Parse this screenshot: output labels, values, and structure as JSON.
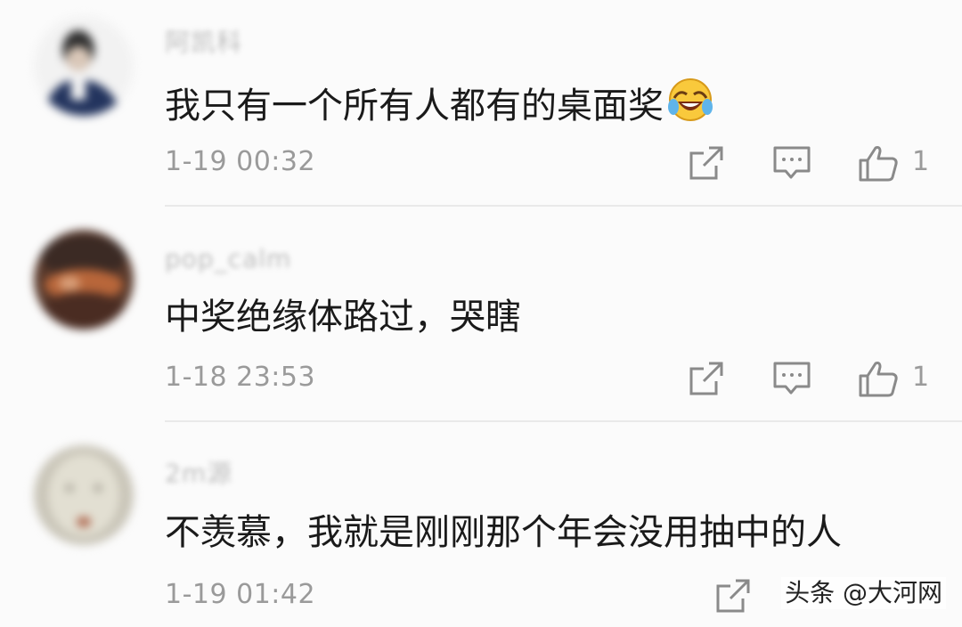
{
  "comments": [
    {
      "username": "阿凯科",
      "text": "我只有一个所有人都有的桌面奖",
      "emoji": "laughing-crying-emoji",
      "time": "1-19 00:32",
      "likes": "1"
    },
    {
      "username": "pop_calm",
      "text": "中奖绝缘体路过，哭瞎",
      "time": "1-18 23:53",
      "likes": "1"
    },
    {
      "username": "2m源",
      "text": "不羡慕，我就是刚刚那个年会没用抽中的人",
      "time": "1-19 01:42"
    }
  ],
  "icons": {
    "share": "share-icon",
    "reply": "reply-icon",
    "like": "thumbs-up-icon"
  },
  "watermark": "头条 @大河网",
  "colors": {
    "background": "#fbfbfb",
    "text": "#1a1a1a",
    "muted": "#9a9a9a",
    "divider": "#e9e9e9"
  }
}
